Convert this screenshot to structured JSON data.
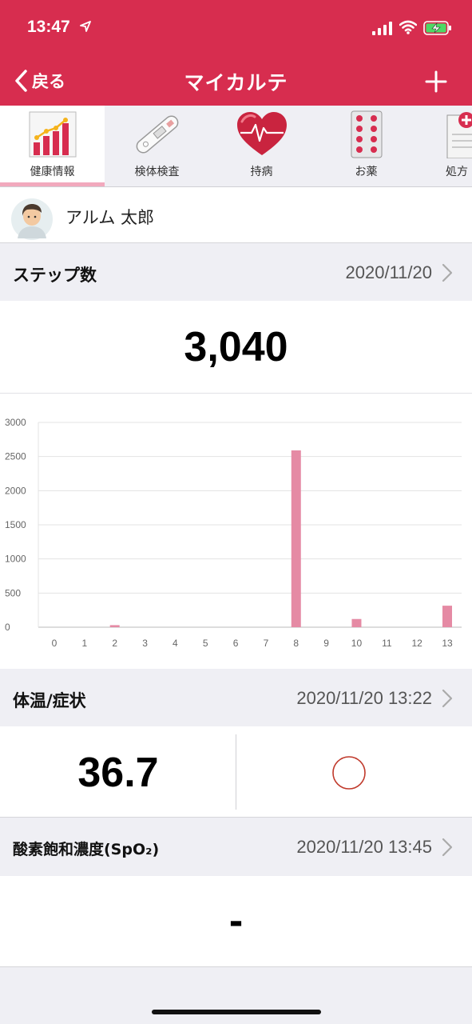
{
  "status_bar": {
    "time": "13:47"
  },
  "nav": {
    "back_label": "戻る",
    "title": "マイカルテ"
  },
  "tabs": [
    {
      "label": "健康情報",
      "icon": "bar-chart-icon",
      "active": true
    },
    {
      "label": "検体検査",
      "icon": "test-kit-icon",
      "active": false
    },
    {
      "label": "持病",
      "icon": "heart-icon",
      "active": false
    },
    {
      "label": "お薬",
      "icon": "pill-pack-icon",
      "active": false
    },
    {
      "label": "処方",
      "icon": "prescription-icon",
      "active": false
    }
  ],
  "user": {
    "name": "アルム 太郎"
  },
  "steps": {
    "title": "ステップ数",
    "date": "2020/11/20",
    "value": "3,040"
  },
  "chart_data": {
    "type": "bar",
    "categories": [
      "0",
      "1",
      "2",
      "3",
      "4",
      "5",
      "6",
      "7",
      "8",
      "9",
      "10",
      "11",
      "12",
      "13"
    ],
    "values": [
      0,
      0,
      30,
      0,
      0,
      0,
      0,
      0,
      2590,
      0,
      120,
      0,
      0,
      315
    ],
    "yticks": [
      "0",
      "500",
      "1000",
      "1500",
      "2000",
      "2500",
      "3000"
    ],
    "ylim": [
      0,
      3000
    ],
    "grid": true,
    "bar_color": "#e58aa4"
  },
  "temperature": {
    "title": "体温/症状",
    "date": "2020/11/20 13:22",
    "value": "36.7",
    "symptom_icon": "circle-icon"
  },
  "spo2": {
    "title": "酸素飽和濃度(SpO₂)",
    "date": "2020/11/20 13:45",
    "value": "-"
  },
  "colors": {
    "brand": "#d72d4f",
    "bar": "#e58aa4",
    "tab_indicator": "#f2a9bd"
  }
}
